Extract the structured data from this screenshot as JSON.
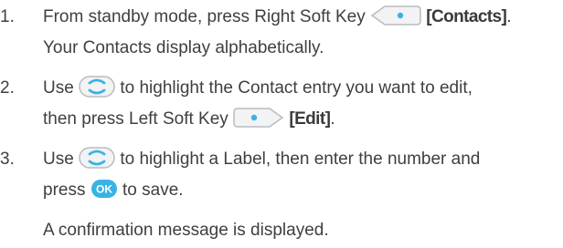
{
  "steps": [
    {
      "number": "1.",
      "lines": [
        {
          "before": "From standby mode, press Right Soft Key",
          "icon": "right-soft-key-icon",
          "bold": "[Contacts]",
          "after": "."
        },
        {
          "text": "Your Contacts display alphabetically."
        }
      ]
    },
    {
      "number": "2.",
      "lines": [
        {
          "before": "Use",
          "icon": "navigation-key-icon",
          "after": "to highlight the Contact entry you want to edit,"
        },
        {
          "before": "then press Left Soft Key",
          "icon": "left-soft-key-icon",
          "bold": "[Edit]",
          "after": "."
        }
      ]
    },
    {
      "number": "3.",
      "lines": [
        {
          "before": "Use",
          "icon": "navigation-key-icon",
          "after": "to highlight a Label, then enter the number and"
        },
        {
          "before": "press",
          "icon": "ok-key-icon",
          "icon_text": "OK",
          "after": "to save."
        }
      ]
    }
  ],
  "note": "A confirmation message is displayed.",
  "colors": {
    "text": "#3f3f3f",
    "key_fill": "#f2f3f4",
    "key_stroke": "#b8bcc0",
    "accent": "#38b3e6"
  }
}
